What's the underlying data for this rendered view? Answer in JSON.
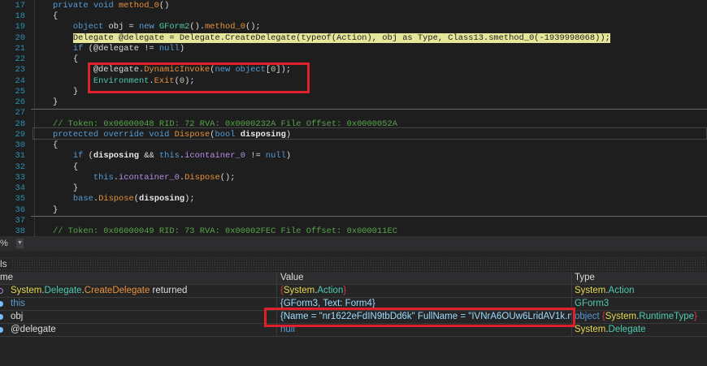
{
  "editor": {
    "lines": [
      {
        "n": "17",
        "tokens": [
          [
            "    ",
            ""
          ],
          [
            "private void ",
            "k"
          ],
          [
            "method_0",
            "m"
          ],
          [
            "()",
            "x"
          ]
        ]
      },
      {
        "n": "18",
        "tokens": [
          [
            "    {",
            "x"
          ]
        ]
      },
      {
        "n": "19",
        "tokens": [
          [
            "        ",
            ""
          ],
          [
            "object ",
            "k"
          ],
          [
            "obj = ",
            "x"
          ],
          [
            "new ",
            "k"
          ],
          [
            "GForm2",
            "t"
          ],
          [
            "().",
            "x"
          ],
          [
            "method_0",
            "m"
          ],
          [
            "();",
            "x"
          ]
        ]
      },
      {
        "n": "20",
        "tokens": [
          [
            "        ",
            ""
          ],
          [
            "Delegate @delegate = Delegate.CreateDelegate(typeof(Action), obj as Type, Class13.smethod_0(-1939998068));",
            "hl"
          ]
        ]
      },
      {
        "n": "21",
        "tokens": [
          [
            "        ",
            ""
          ],
          [
            "if ",
            "k"
          ],
          [
            "(@delegate != ",
            "x"
          ],
          [
            "null",
            "k"
          ],
          [
            ")",
            "x"
          ]
        ]
      },
      {
        "n": "22",
        "tokens": [
          [
            "        {",
            "x"
          ]
        ]
      },
      {
        "n": "23",
        "tokens": [
          [
            "            @delegate.",
            "x"
          ],
          [
            "DynamicInvoke",
            "m"
          ],
          [
            "(",
            "x"
          ],
          [
            "new object",
            "k"
          ],
          [
            "[",
            "x"
          ],
          [
            "0",
            "n"
          ],
          [
            "]);",
            "x"
          ]
        ]
      },
      {
        "n": "24",
        "tokens": [
          [
            "            ",
            ""
          ],
          [
            "Environment",
            "t"
          ],
          [
            ".",
            "x"
          ],
          [
            "Exit",
            "m"
          ],
          [
            "(",
            "x"
          ],
          [
            "0",
            "n"
          ],
          [
            ");",
            "x"
          ]
        ]
      },
      {
        "n": "25",
        "tokens": [
          [
            "        }",
            "x"
          ]
        ]
      },
      {
        "n": "26",
        "tokens": [
          [
            "    }",
            "x"
          ]
        ]
      },
      {
        "n": "27",
        "tokens": []
      },
      {
        "n": "28",
        "tokens": [
          [
            "    ",
            ""
          ],
          [
            "// Token: 0x06000048 RID: 72 RVA: 0x0000232A File Offset: 0x0000052A",
            "c"
          ]
        ]
      },
      {
        "n": "29",
        "tokens": [
          [
            "    ",
            ""
          ],
          [
            "protected override void ",
            "k"
          ],
          [
            "Dispose",
            "m"
          ],
          [
            "(",
            "x"
          ],
          [
            "bool ",
            "k"
          ],
          [
            "disposing",
            "p"
          ],
          [
            ")",
            "x"
          ]
        ]
      },
      {
        "n": "30",
        "tokens": [
          [
            "    {",
            "x"
          ]
        ]
      },
      {
        "n": "31",
        "tokens": [
          [
            "        ",
            ""
          ],
          [
            "if ",
            "k"
          ],
          [
            "(",
            "x"
          ],
          [
            "disposing",
            "p"
          ],
          [
            " && ",
            "x"
          ],
          [
            "this",
            "k"
          ],
          [
            ".",
            "x"
          ],
          [
            "icontainer_0",
            "f"
          ],
          [
            " != ",
            "x"
          ],
          [
            "null",
            "k"
          ],
          [
            ")",
            "x"
          ]
        ]
      },
      {
        "n": "32",
        "tokens": [
          [
            "        {",
            "x"
          ]
        ]
      },
      {
        "n": "33",
        "tokens": [
          [
            "            ",
            ""
          ],
          [
            "this",
            "k"
          ],
          [
            ".",
            "x"
          ],
          [
            "icontainer_0",
            "f"
          ],
          [
            ".",
            "x"
          ],
          [
            "Dispose",
            "m"
          ],
          [
            "();",
            "x"
          ]
        ]
      },
      {
        "n": "34",
        "tokens": [
          [
            "        }",
            "x"
          ]
        ]
      },
      {
        "n": "35",
        "tokens": [
          [
            "        ",
            ""
          ],
          [
            "base",
            "k"
          ],
          [
            ".",
            "x"
          ],
          [
            "Dispose",
            "m"
          ],
          [
            "(",
            "x"
          ],
          [
            "disposing",
            "p"
          ],
          [
            ");",
            "x"
          ]
        ]
      },
      {
        "n": "36",
        "tokens": [
          [
            "    }",
            "x"
          ]
        ]
      },
      {
        "n": "37",
        "tokens": []
      },
      {
        "n": "38",
        "tokens": [
          [
            "    ",
            ""
          ],
          [
            "// Token: 0x06000049 RID: 73 RVA: 0x00002FEC File Offset: 0x000011EC",
            "c"
          ]
        ]
      }
    ]
  },
  "toolbar": {
    "zoom_label": "%"
  },
  "locals": {
    "title": "ls",
    "headers": {
      "name": "me",
      "value": "Value",
      "type": "Type"
    },
    "rows": [
      {
        "name": "System.Delegate.CreateDelegate returned",
        "value": "{System.Action}",
        "type": "System.Action"
      },
      {
        "name": "this",
        "value": "{GForm3, Text: Form4}",
        "type": "GForm3"
      },
      {
        "name": "obj",
        "value": "{Name = \"nr1622eFdIN9tbDd6k\" FullName = \"IVNrA6OUw6LridAV1k.nr1...",
        "type": "object {System.RuntimeType}"
      },
      {
        "name": "@delegate",
        "value": "null",
        "type": "System.Delegate"
      }
    ]
  },
  "colors": {
    "highlight": "#e6e69a",
    "annotation_box": "#e0202a"
  }
}
